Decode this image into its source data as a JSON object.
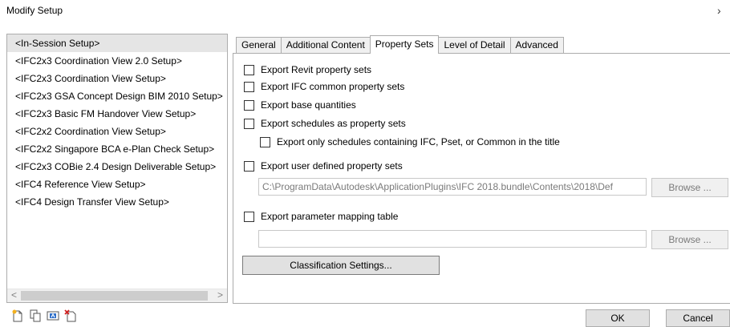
{
  "window": {
    "title": "Modify Setup",
    "chevron": "›"
  },
  "setups": [
    {
      "label": "<In-Session Setup>",
      "selected": true
    },
    {
      "label": "<IFC2x3 Coordination View 2.0 Setup>"
    },
    {
      "label": "<IFC2x3 Coordination View Setup>"
    },
    {
      "label": "<IFC2x3 GSA Concept Design BIM 2010 Setup>"
    },
    {
      "label": "<IFC2x3 Basic FM Handover View Setup>"
    },
    {
      "label": "<IFC2x2 Coordination View Setup>"
    },
    {
      "label": "<IFC2x2 Singapore BCA e-Plan Check Setup>"
    },
    {
      "label": "<IFC2x3 COBie 2.4 Design Deliverable Setup>"
    },
    {
      "label": "<IFC4 Reference View Setup>"
    },
    {
      "label": "<IFC4 Design Transfer View Setup>"
    }
  ],
  "scrollbar": {
    "left": "<",
    "right": ">"
  },
  "toolbar_icons": [
    "new-setup-icon",
    "duplicate-setup-icon",
    "rename-setup-icon",
    "delete-setup-icon"
  ],
  "tabs": [
    {
      "label": "General"
    },
    {
      "label": "Additional Content"
    },
    {
      "label": "Property Sets",
      "active": true
    },
    {
      "label": "Level of Detail"
    },
    {
      "label": "Advanced"
    }
  ],
  "property_sets": {
    "export_revit": "Export Revit property sets",
    "export_ifc_common": "Export IFC common property sets",
    "export_base_quantities": "Export base quantities",
    "export_schedules": "Export schedules as property sets",
    "export_only_schedules": "Export only schedules containing IFC, Pset, or Common in the title",
    "export_user_defined": "Export user defined property sets",
    "user_defined_path": "C:\\ProgramData\\Autodesk\\ApplicationPlugins\\IFC 2018.bundle\\Contents\\2018\\Def",
    "browse_label": "Browse ...",
    "export_mapping_table": "Export parameter mapping table",
    "mapping_path": "",
    "classification_button": "Classification Settings..."
  },
  "buttons": {
    "ok": "OK",
    "cancel": "Cancel"
  }
}
